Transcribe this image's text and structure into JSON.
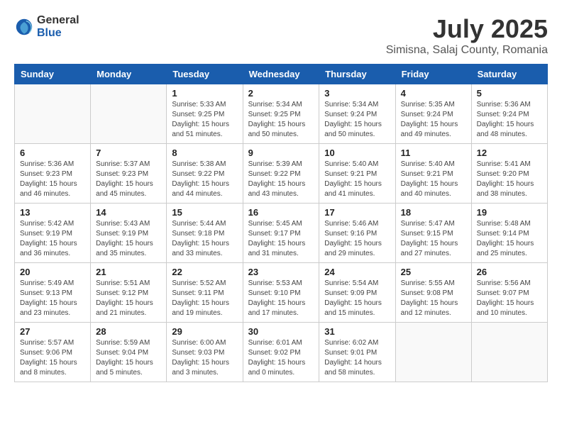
{
  "header": {
    "logo_general": "General",
    "logo_blue": "Blue",
    "title": "July 2025",
    "subtitle": "Simisna, Salaj County, Romania"
  },
  "days_of_week": [
    "Sunday",
    "Monday",
    "Tuesday",
    "Wednesday",
    "Thursday",
    "Friday",
    "Saturday"
  ],
  "weeks": [
    [
      {
        "day": "",
        "info": ""
      },
      {
        "day": "",
        "info": ""
      },
      {
        "day": "1",
        "info": "Sunrise: 5:33 AM\nSunset: 9:25 PM\nDaylight: 15 hours\nand 51 minutes."
      },
      {
        "day": "2",
        "info": "Sunrise: 5:34 AM\nSunset: 9:25 PM\nDaylight: 15 hours\nand 50 minutes."
      },
      {
        "day": "3",
        "info": "Sunrise: 5:34 AM\nSunset: 9:24 PM\nDaylight: 15 hours\nand 50 minutes."
      },
      {
        "day": "4",
        "info": "Sunrise: 5:35 AM\nSunset: 9:24 PM\nDaylight: 15 hours\nand 49 minutes."
      },
      {
        "day": "5",
        "info": "Sunrise: 5:36 AM\nSunset: 9:24 PM\nDaylight: 15 hours\nand 48 minutes."
      }
    ],
    [
      {
        "day": "6",
        "info": "Sunrise: 5:36 AM\nSunset: 9:23 PM\nDaylight: 15 hours\nand 46 minutes."
      },
      {
        "day": "7",
        "info": "Sunrise: 5:37 AM\nSunset: 9:23 PM\nDaylight: 15 hours\nand 45 minutes."
      },
      {
        "day": "8",
        "info": "Sunrise: 5:38 AM\nSunset: 9:22 PM\nDaylight: 15 hours\nand 44 minutes."
      },
      {
        "day": "9",
        "info": "Sunrise: 5:39 AM\nSunset: 9:22 PM\nDaylight: 15 hours\nand 43 minutes."
      },
      {
        "day": "10",
        "info": "Sunrise: 5:40 AM\nSunset: 9:21 PM\nDaylight: 15 hours\nand 41 minutes."
      },
      {
        "day": "11",
        "info": "Sunrise: 5:40 AM\nSunset: 9:21 PM\nDaylight: 15 hours\nand 40 minutes."
      },
      {
        "day": "12",
        "info": "Sunrise: 5:41 AM\nSunset: 9:20 PM\nDaylight: 15 hours\nand 38 minutes."
      }
    ],
    [
      {
        "day": "13",
        "info": "Sunrise: 5:42 AM\nSunset: 9:19 PM\nDaylight: 15 hours\nand 36 minutes."
      },
      {
        "day": "14",
        "info": "Sunrise: 5:43 AM\nSunset: 9:19 PM\nDaylight: 15 hours\nand 35 minutes."
      },
      {
        "day": "15",
        "info": "Sunrise: 5:44 AM\nSunset: 9:18 PM\nDaylight: 15 hours\nand 33 minutes."
      },
      {
        "day": "16",
        "info": "Sunrise: 5:45 AM\nSunset: 9:17 PM\nDaylight: 15 hours\nand 31 minutes."
      },
      {
        "day": "17",
        "info": "Sunrise: 5:46 AM\nSunset: 9:16 PM\nDaylight: 15 hours\nand 29 minutes."
      },
      {
        "day": "18",
        "info": "Sunrise: 5:47 AM\nSunset: 9:15 PM\nDaylight: 15 hours\nand 27 minutes."
      },
      {
        "day": "19",
        "info": "Sunrise: 5:48 AM\nSunset: 9:14 PM\nDaylight: 15 hours\nand 25 minutes."
      }
    ],
    [
      {
        "day": "20",
        "info": "Sunrise: 5:49 AM\nSunset: 9:13 PM\nDaylight: 15 hours\nand 23 minutes."
      },
      {
        "day": "21",
        "info": "Sunrise: 5:51 AM\nSunset: 9:12 PM\nDaylight: 15 hours\nand 21 minutes."
      },
      {
        "day": "22",
        "info": "Sunrise: 5:52 AM\nSunset: 9:11 PM\nDaylight: 15 hours\nand 19 minutes."
      },
      {
        "day": "23",
        "info": "Sunrise: 5:53 AM\nSunset: 9:10 PM\nDaylight: 15 hours\nand 17 minutes."
      },
      {
        "day": "24",
        "info": "Sunrise: 5:54 AM\nSunset: 9:09 PM\nDaylight: 15 hours\nand 15 minutes."
      },
      {
        "day": "25",
        "info": "Sunrise: 5:55 AM\nSunset: 9:08 PM\nDaylight: 15 hours\nand 12 minutes."
      },
      {
        "day": "26",
        "info": "Sunrise: 5:56 AM\nSunset: 9:07 PM\nDaylight: 15 hours\nand 10 minutes."
      }
    ],
    [
      {
        "day": "27",
        "info": "Sunrise: 5:57 AM\nSunset: 9:06 PM\nDaylight: 15 hours\nand 8 minutes."
      },
      {
        "day": "28",
        "info": "Sunrise: 5:59 AM\nSunset: 9:04 PM\nDaylight: 15 hours\nand 5 minutes."
      },
      {
        "day": "29",
        "info": "Sunrise: 6:00 AM\nSunset: 9:03 PM\nDaylight: 15 hours\nand 3 minutes."
      },
      {
        "day": "30",
        "info": "Sunrise: 6:01 AM\nSunset: 9:02 PM\nDaylight: 15 hours\nand 0 minutes."
      },
      {
        "day": "31",
        "info": "Sunrise: 6:02 AM\nSunset: 9:01 PM\nDaylight: 14 hours\nand 58 minutes."
      },
      {
        "day": "",
        "info": ""
      },
      {
        "day": "",
        "info": ""
      }
    ]
  ]
}
